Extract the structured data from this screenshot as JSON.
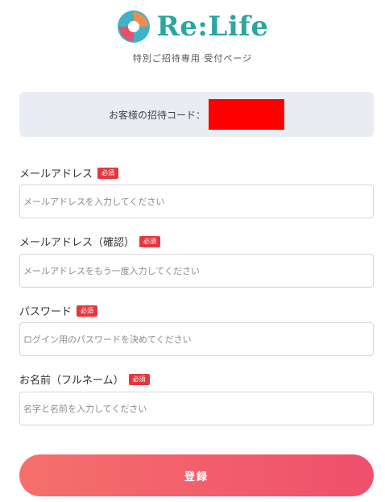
{
  "header": {
    "logo_text": "Re:Life",
    "subtitle": "特別ご招待専用 受付ページ"
  },
  "invite": {
    "label": "お客様の招待コード：",
    "redacted_color": "#ff0000"
  },
  "form": {
    "required_badge": "必須",
    "fields": [
      {
        "label": "メールアドレス",
        "placeholder": "メールアドレスを入力してください"
      },
      {
        "label": "メールアドレス（確認）",
        "placeholder": "メールアドレスをもう一度入力してください"
      },
      {
        "label": "パスワード",
        "placeholder": "ログイン用のパスワードを決めてください"
      },
      {
        "label": "お名前（フルネーム）",
        "placeholder": "名字と名前を入力してください"
      }
    ],
    "submit_label": "登録"
  },
  "colors": {
    "brand_teal": "#2aa7a0",
    "badge_red": "#e4383f",
    "button_start": "#f5706c",
    "button_end": "#ef4f6c"
  }
}
